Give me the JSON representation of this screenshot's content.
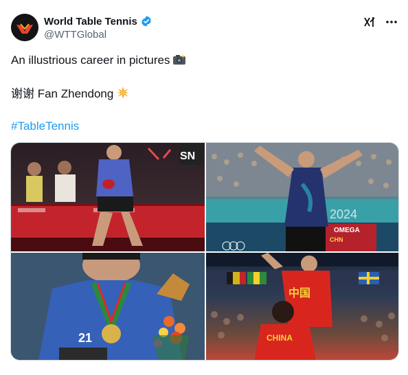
{
  "account": {
    "display_name": "World Table Tennis",
    "handle": "@WTTGlobal",
    "verified": true
  },
  "tweet": {
    "line1": "An illustrious career in pictures",
    "line1_emoji": "camera-with-flash-emoji",
    "line2": "谢谢 Fan Zhendong",
    "line2_emoji": "sparkle-star-emoji",
    "hashtag": "#TableTennis"
  },
  "media": {
    "count": 4,
    "photos": [
      {
        "name": "photo-serving-player",
        "overlay_text": "SN"
      },
      {
        "name": "photo-celebrating-arms-raised",
        "overlay_text": "OMEGA",
        "overlay_text2": "2024",
        "overlay_text3": "CHN"
      },
      {
        "name": "photo-medal-podium",
        "overlay_text": "21"
      },
      {
        "name": "photo-embrace-coach",
        "overlay_text": "CHINA"
      }
    ]
  },
  "icons": {
    "verified": "verified-badge-icon",
    "grok": "grok-icon",
    "more": "more-options-icon"
  },
  "colors": {
    "accent": "#1d9bf0",
    "text": "#0f1419",
    "secondary": "#536471"
  }
}
